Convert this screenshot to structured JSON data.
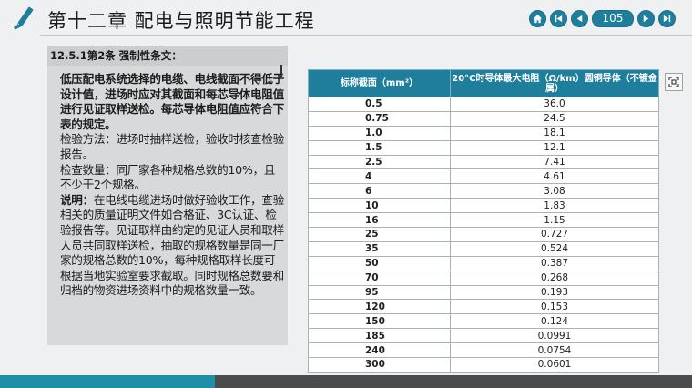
{
  "header": {
    "title": "第十二章 配电与照明节能工程",
    "page": "105"
  },
  "colors": {
    "accent": "#1f7e9c",
    "footer_dark": "#4a4c4d",
    "footer_accent": "#1f8fa8"
  },
  "icons": [
    "pencil-logo-icon",
    "home-icon",
    "first-page-icon",
    "prev-page-icon",
    "next-page-icon",
    "last-page-icon",
    "fullscreen-icon"
  ],
  "left": {
    "heading": "12.5.1第2条 强制性条文：",
    "bold_text": "低压配电系统选择的电缆、电线截面不得低于设计值，进场时应对其截面和每芯导体电阻值进行见证取样送检。每芯导体电阻值应符合下表的规定。",
    "p_method": "检验方法：进场时抽样送检，验收时核查检验报告。",
    "p_quantity": "检查数量：同厂家各种规格总数的10%，且不少于2个规格。",
    "note_label": "说明：",
    "note_text": "在电线电缆进场时做好验收工作，查验相关的质量证明文件如合格证、3C认证、检验报告等。见证取样由约定的见证人员和取样人员共同取样送检，抽取的规格数量是同一厂家的规格总数的10%，每种规格取样长度可根据当地实验室要求截取。同时规格总数要和归档的物资进场资料中的规格数量一致。"
  },
  "table": {
    "col1_header": "标称截面（mm²）",
    "col2_header": "20°C时导体最大电阻（Ω/km）圆铜导体（不镀金属）",
    "rows": [
      {
        "size": "0.5",
        "resistance": "36.0"
      },
      {
        "size": "0.75",
        "resistance": "24.5"
      },
      {
        "size": "1.0",
        "resistance": "18.1"
      },
      {
        "size": "1.5",
        "resistance": "12.1"
      },
      {
        "size": "2.5",
        "resistance": "7.41"
      },
      {
        "size": "4",
        "resistance": "4.61"
      },
      {
        "size": "6",
        "resistance": "3.08"
      },
      {
        "size": "10",
        "resistance": "1.83"
      },
      {
        "size": "16",
        "resistance": "1.15"
      },
      {
        "size": "25",
        "resistance": "0.727"
      },
      {
        "size": "35",
        "resistance": "0.524"
      },
      {
        "size": "50",
        "resistance": "0.387"
      },
      {
        "size": "70",
        "resistance": "0.268"
      },
      {
        "size": "95",
        "resistance": "0.193"
      },
      {
        "size": "120",
        "resistance": "0.153"
      },
      {
        "size": "150",
        "resistance": "0.124"
      },
      {
        "size": "185",
        "resistance": "0.0991"
      },
      {
        "size": "240",
        "resistance": "0.0754"
      },
      {
        "size": "300",
        "resistance": "0.0601"
      }
    ]
  }
}
